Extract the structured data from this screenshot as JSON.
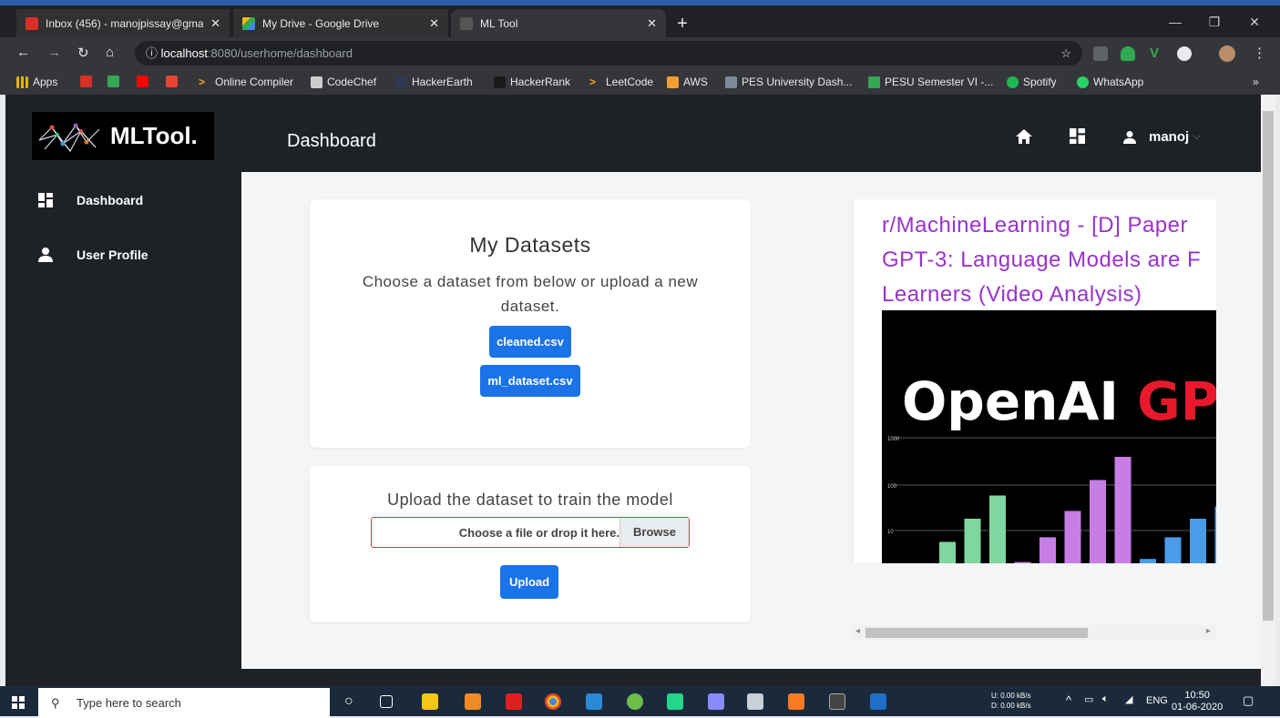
{
  "browser": {
    "tabs": [
      {
        "title": "Inbox (456) - manojpissay@gmai",
        "icon": "gmail-icon",
        "active": false
      },
      {
        "title": "My Drive - Google Drive",
        "icon": "drive-icon",
        "active": false
      },
      {
        "title": "ML Tool",
        "icon": "mltool-icon",
        "active": true
      }
    ],
    "url_host": "localhost",
    "url_path": ":8080/userhome/dashboard",
    "bookmarks": [
      {
        "label": "Apps"
      },
      {
        "label": ""
      },
      {
        "label": ""
      },
      {
        "label": ""
      },
      {
        "label": ""
      },
      {
        "label": "Online Compiler"
      },
      {
        "label": "CodeChef"
      },
      {
        "label": "HackerEarth"
      },
      {
        "label": "HackerRank"
      },
      {
        "label": "LeetCode"
      },
      {
        "label": "AWS"
      },
      {
        "label": "PES University Dash..."
      },
      {
        "label": "PESU Semester VI -..."
      },
      {
        "label": "Spotify"
      },
      {
        "label": "WhatsApp"
      }
    ],
    "overflow": "»"
  },
  "app": {
    "logo_text": "MLTool.",
    "page_title": "Dashboard",
    "user_name": "manoj",
    "sidebar": [
      {
        "label": "Dashboard",
        "icon": "dashboard-icon"
      },
      {
        "label": "User Profile",
        "icon": "user-icon"
      }
    ]
  },
  "datasets_card": {
    "title": "My Datasets",
    "subtitle": "Choose a dataset from below or upload a new dataset.",
    "datasets": [
      "cleaned.csv",
      "ml_dataset.csv"
    ]
  },
  "upload_card": {
    "title": "Upload the dataset to train the model",
    "file_placeholder": "Choose a file or drop it here.",
    "browse_label": "Browse",
    "upload_label": "Upload"
  },
  "embed": {
    "title": "r/MachineLearning - [D] Paper GPT-3: Language Models are F Learners (Video Analysis)",
    "title_lines": [
      "r/MachineLearning - [D] Paper",
      "GPT-3: Language Models are F",
      "Learners (Video Analysis)"
    ],
    "image_text_white": "OpenAI ",
    "image_text_red": "GPT",
    "axis_ticks": [
      "1000",
      "100",
      "10"
    ],
    "bars": [
      {
        "color": "#7fd6a0",
        "value": 0.15
      },
      {
        "color": "#7fd6a0",
        "value": 0.3
      },
      {
        "color": "#7fd6a0",
        "value": 0.45
      },
      {
        "color": "#c77de6",
        "value": 0.02
      },
      {
        "color": "#c77de6",
        "value": 0.18
      },
      {
        "color": "#c77de6",
        "value": 0.35
      },
      {
        "color": "#c77de6",
        "value": 0.55
      },
      {
        "color": "#c77de6",
        "value": 0.7
      },
      {
        "color": "#4a9be8",
        "value": 0.04
      },
      {
        "color": "#4a9be8",
        "value": 0.18
      },
      {
        "color": "#4a9be8",
        "value": 0.3
      },
      {
        "color": "#4a9be8",
        "value": 0.38
      }
    ]
  },
  "taskbar": {
    "search_placeholder": "Type here to search",
    "net_up": "U:     0.00 kB/s",
    "net_down": "D:     0.00 kB/s",
    "lang": "ENG",
    "time": "10:50",
    "date": "01-06-2020"
  }
}
